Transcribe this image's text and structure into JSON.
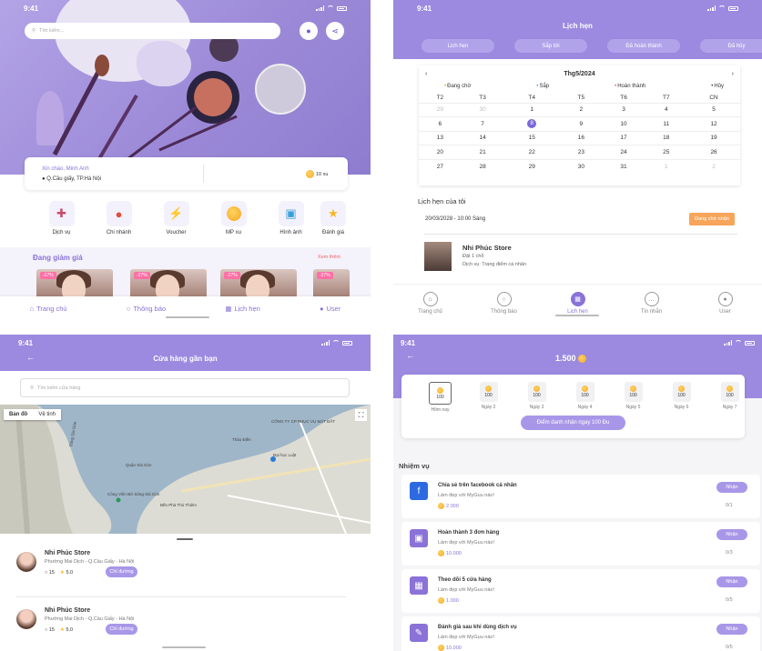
{
  "status": {
    "time": "9:41"
  },
  "home": {
    "search_placeholder": "Tìm kiếm...",
    "greeting": "Xin chào, Minh Anh",
    "address": "Q.Cầu giấy, TP.Hà Nội",
    "xu": "10 xu",
    "services": [
      {
        "label": "Dịch vụ",
        "icon": "lipstick-icon"
      },
      {
        "label": "Chi nhánh",
        "icon": "location-pin-icon"
      },
      {
        "label": "Voucher",
        "icon": "lightning-icon"
      },
      {
        "label": "MP xu",
        "icon": "coin-icon"
      },
      {
        "label": "Hình ảnh",
        "icon": "image-icon"
      },
      {
        "label": "Đánh giá",
        "icon": "star-icon"
      }
    ],
    "promo_title": "Đang giảm giá",
    "promo_more": "Xem thêm",
    "deals": [
      {
        "pct": "-27%"
      },
      {
        "pct": "-27%"
      },
      {
        "pct": "-27%"
      },
      {
        "pct": "-27%"
      }
    ],
    "nav": [
      "Trang chủ",
      "Thông báo",
      "Lịch hẹn",
      "User"
    ]
  },
  "schedule": {
    "title": "Lịch hẹn",
    "tabs": [
      "Lịch hẹn",
      "Sắp tới",
      "Đã hoàn thành",
      "Đã hủy"
    ],
    "month": "Thg5/2024",
    "legend": [
      {
        "label": "Đang chờ",
        "color": "#f5a623"
      },
      {
        "label": "Sắp",
        "color": "#3ab0e0"
      },
      {
        "label": "Hoàn thành",
        "color": "#e94e77"
      },
      {
        "label": "Hủy",
        "color": "#333333"
      }
    ],
    "weekdays": [
      "T2",
      "T3",
      "T4",
      "T5",
      "T6",
      "T7",
      "CN"
    ],
    "weeks": [
      [
        "29",
        "30",
        "1",
        "2",
        "3",
        "4",
        "5"
      ],
      [
        "6",
        "7",
        "8",
        "9",
        "10",
        "11",
        "12"
      ],
      [
        "13",
        "14",
        "15",
        "16",
        "17",
        "18",
        "19"
      ],
      [
        "20",
        "21",
        "22",
        "23",
        "24",
        "25",
        "26"
      ],
      [
        "27",
        "28",
        "29",
        "30",
        "31",
        "1",
        "2"
      ]
    ],
    "my_title": "Lịch hẹn của tôi",
    "appt_date": "20/03/2028 - 10:00 Sáng",
    "status_btn": "Đang chờ nhận",
    "store_name": "Nhi Phúc Store",
    "store_people": "Đặt 1 chỗ",
    "store_service": "Dịch vụ: Trang điểm cá nhân",
    "nav": [
      "Trang chủ",
      "Thông báo",
      "Lịch hẹn",
      "Tin nhắn",
      "User"
    ]
  },
  "nearby": {
    "title": "Cửa hàng gần bạn",
    "search_placeholder": "Tìm kiếm cửa hàng",
    "map_toggle": [
      "Bản đồ",
      "Vệ tinh"
    ],
    "map_labels": [
      "Sông Sài Gòn",
      "CÔNG TY CP PHỤC VỤ MẶT ĐẤT",
      "Quận Sài Gòn",
      "Công Viên Bờ Sông Sài Gòn",
      "Thảo Điền",
      "Đại học Luật",
      "Bến Phà Thủ Thiêm"
    ],
    "stores": [
      {
        "name": "Nhi Phúc Store",
        "address": "Phường Mai Dịch - Q.Cầu Giấy - Hà Nội",
        "comments": "15",
        "rating": "5.0",
        "dir": "Chỉ đường"
      },
      {
        "name": "Nhi Phúc Store",
        "address": "Phường Mai Dịch - Q.Cầu Giấy - Hà Nội",
        "comments": "15",
        "rating": "5.0",
        "dir": "Chỉ đường"
      }
    ]
  },
  "rewards": {
    "points": "1.500",
    "days": [
      {
        "label": "Hôm nay",
        "pts": "100"
      },
      {
        "label": "Ngày 2",
        "pts": "100"
      },
      {
        "label": "Ngày 3",
        "pts": "100"
      },
      {
        "label": "Ngày 4",
        "pts": "100"
      },
      {
        "label": "Ngày 5",
        "pts": "100"
      },
      {
        "label": "Ngày 6",
        "pts": "100"
      },
      {
        "label": "Ngày 7",
        "pts": "100"
      }
    ],
    "checkin_btn": "Điểm danh nhận ngay 100 Đu",
    "tasks_title": "Nhiệm vụ",
    "tasks": [
      {
        "title": "Chia sẻ trên facebook cá nhân",
        "sub": "Làm đẹp với MyGuu nào!",
        "reward": "2.000",
        "btn": "Nhận",
        "progress": "0/1",
        "icon": "facebook-icon",
        "color": "#2d6ae0"
      },
      {
        "title": "Hoàn thành 3 đơn hàng",
        "sub": "Làm đẹp với MyGuu nào!",
        "reward": "10.000",
        "btn": "Nhận",
        "progress": "0/3",
        "icon": "cart-icon",
        "color": "#8a72d8"
      },
      {
        "title": "Theo dõi 5 cửa hàng",
        "sub": "Làm đẹp với MyGuu nào!",
        "reward": "1.000",
        "btn": "Nhận",
        "progress": "0/5",
        "icon": "shop-icon",
        "color": "#8a72d8"
      },
      {
        "title": "Đánh giá sau khi dùng dịch vụ",
        "sub": "Làm đẹp với MyGuu nào!",
        "reward": "10.000",
        "btn": "Nhận",
        "progress": "0/5",
        "icon": "review-icon",
        "color": "#8a72d8"
      }
    ]
  }
}
